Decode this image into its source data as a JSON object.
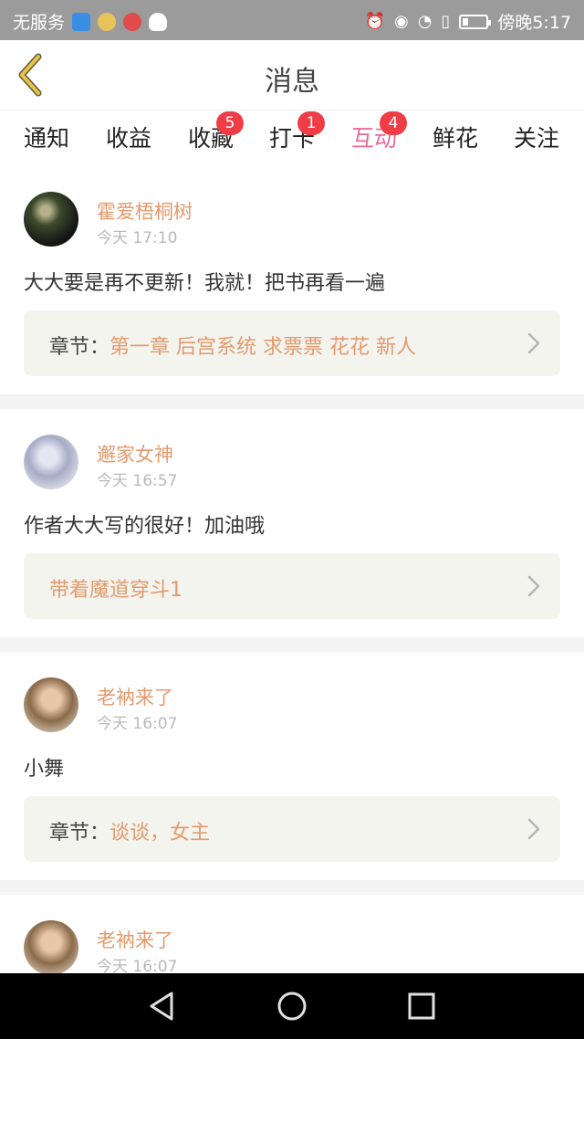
{
  "status_bar": {
    "carrier": "无服务",
    "time": "傍晚5:17",
    "battery_level": 0.25,
    "icons_left": [
      "shield-icon",
      "bulb-icon",
      "music-icon",
      "qq-icon"
    ],
    "icons_right": [
      "alarm-icon",
      "eye-icon",
      "wifi-icon",
      "sim-alert-icon",
      "battery-icon"
    ]
  },
  "header": {
    "title": "消息",
    "back_icon": "chevron-left-icon"
  },
  "tabs": [
    {
      "label": "通知",
      "badge": ""
    },
    {
      "label": "收益",
      "badge": ""
    },
    {
      "label": "收藏",
      "badge": "5"
    },
    {
      "label": "打卡",
      "badge": "1"
    },
    {
      "label": "互动",
      "badge": "4",
      "active": true
    },
    {
      "label": "鲜花",
      "badge": ""
    },
    {
      "label": "关注",
      "badge": ""
    }
  ],
  "messages": [
    {
      "name": "霍爱梧桐树",
      "time": "今天 17:10",
      "content": "大大要是再不更新！我就！把书再看一遍",
      "ref_prefix": "章节：",
      "ref_text": "第一章  后宫系统 求票票 花花 新人"
    },
    {
      "name": "邂家女神",
      "time": "今天 16:57",
      "content": "作者大大写的很好！加油哦",
      "ref_prefix": "",
      "ref_text": "带着魔道穿斗1"
    },
    {
      "name": "老衲来了",
      "time": "今天 16:07",
      "content": "小舞",
      "ref_prefix": "章节：",
      "ref_text": "谈谈，女主"
    },
    {
      "name": "老衲来了",
      "time": "今天 16:07"
    }
  ],
  "colors": {
    "accent_pink": "#e96a9a",
    "name_orange": "#e39a6d",
    "badge_red": "#ef3d45",
    "ref_bg": "#f4f4ef",
    "back_yellow": "#e9c24a"
  }
}
